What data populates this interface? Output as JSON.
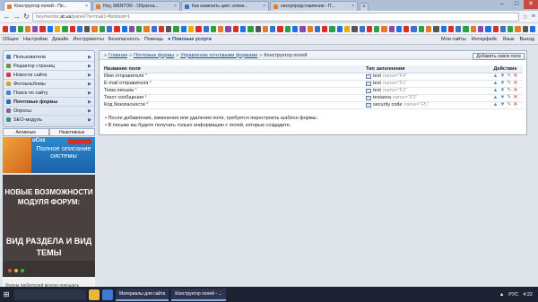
{
  "browser": {
    "tabs": [
      {
        "title": "Конструктор полей - По...",
        "active": true,
        "favicon_color": "#e57b2a"
      },
      {
        "title": "Hey, MENTOR - Обратна...",
        "active": false,
        "favicon_color": "#e57b2a"
      },
      {
        "title": "Как изменить цвет элеме...",
        "active": false,
        "favicon_color": "#3b6fd0"
      },
      {
        "title": "некорпредставления - П...",
        "active": false,
        "favicon_color": "#e57b2a"
      }
    ],
    "url_prefix": "heymentor.",
    "url_domain": "at.ua",
    "url_path": "/panel/?a=mail1=fieldsid=1",
    "bookmark_colors": [
      "#d93025",
      "#3b6fd0",
      "#2f9e44",
      "#e57b2a",
      "#8b4aa8",
      "#d93025",
      "#1a73e8",
      "#f2a900",
      "#2f9e44",
      "#d93025",
      "#3b6fd0",
      "#555",
      "#e57b2a",
      "#2f9e44",
      "#3b6fd0",
      "#d93025",
      "#1a73e8",
      "#8b4aa8",
      "#2f9e44",
      "#e57b2a",
      "#3b6fd0",
      "#d93025",
      "#555",
      "#2f9e44",
      "#1a73e8",
      "#f2a900",
      "#d93025",
      "#3b6fd0",
      "#2f9e44",
      "#e57b2a",
      "#8b4aa8",
      "#d93025",
      "#1a73e8",
      "#2f9e44",
      "#555",
      "#e57b2a",
      "#3b6fd0",
      "#d93025",
      "#2f9e44",
      "#1a73e8",
      "#8b4aa8",
      "#e57b2a",
      "#3b6fd0",
      "#d93025",
      "#2f9e44",
      "#1a73e8",
      "#f2a900",
      "#555",
      "#3b6fd0",
      "#d93025",
      "#2f9e44",
      "#e57b2a",
      "#8b4aa8",
      "#1a73e8",
      "#d93025",
      "#3b6fd0",
      "#2f9e44",
      "#e57b2a",
      "#555",
      "#1a73e8",
      "#d93025",
      "#3b6fd0",
      "#2f9e44",
      "#e57b2a",
      "#8b4aa8",
      "#1a73e8",
      "#d93025",
      "#3b6fd0",
      "#2f9e44",
      "#e57b2a",
      "#555",
      "#1a73e8"
    ]
  },
  "ucoz_bar": {
    "items": [
      "Общее",
      "Настройки",
      "Дизайн",
      "Инструменты",
      "Безопасность",
      "Помощь"
    ],
    "paid": "Платные услуги",
    "right": [
      "Мои сайты",
      "Интерфейс",
      "Язык",
      "Выход"
    ]
  },
  "sidebar": {
    "items": [
      {
        "label": "Пользователи",
        "color": "#4f7fc4",
        "bold": false
      },
      {
        "label": "Редактор страниц",
        "color": "#5b9a3f",
        "bold": false
      },
      {
        "label": "Новости сайта",
        "color": "#c7423a",
        "bold": false
      },
      {
        "label": "Фотоальбомы",
        "color": "#d9a12b",
        "bold": false
      },
      {
        "label": "Поиск по сайту",
        "color": "#4f7fc4",
        "bold": false
      },
      {
        "label": "Почтовые формы",
        "color": "#2f6fb8",
        "bold": true
      },
      {
        "label": "Опросы",
        "color": "#8a5fb0",
        "bold": false
      },
      {
        "label": "SEO-модуль",
        "color": "#3e8d7d",
        "bold": false
      }
    ],
    "tab_active": "Активные",
    "tab_inactive": "Неактивные"
  },
  "ads": {
    "ucoz_logo": "uCoz",
    "ucoz_text": "Полное описание системы",
    "forum_line1": "НОВЫЕ ВОЗМОЖНОСТИ МОДУЛЯ ФОРУМ:",
    "forum_line2": "ВИД РАЗДЕЛА И ВИД ТЕМЫ",
    "forum_caption": "Форум любителей вкусно покушать",
    "dot_colors": [
      "#e55050",
      "#f2b43a",
      "#4caf50"
    ]
  },
  "main": {
    "breadcrumbs": [
      "Главная",
      "Почтовые формы",
      "Управление почтовыми формами"
    ],
    "breadcrumb_current": "Конструктор полей",
    "add_button": "Добавить новое поле",
    "columns": {
      "name": "Название поля",
      "type": "Тип заполнения",
      "action": "Действие"
    },
    "rows": [
      {
        "name": "Имя отправителя",
        "type": "text",
        "fname": "name=\"F4\""
      },
      {
        "name": "E-mail отправителя",
        "type": "text",
        "fname": "name=\"F1\""
      },
      {
        "name": "Тема письма",
        "type": "text",
        "fname": "name=\"F2\""
      },
      {
        "name": "Текст сообщения",
        "type": "textarea",
        "fname": "name=\"F3\""
      },
      {
        "name": "Код безопасности",
        "type": "security code",
        "fname": "name=\"F5\""
      }
    ],
    "required_mark": "*",
    "notes": [
      "После добавления, изменения или удаления поля, требуется перестроить шаблон формы.",
      "В письме вы будете получать только информацию с полей, которые создадите."
    ]
  },
  "taskbar": {
    "search_placeholder": "",
    "apps": [
      "Материалы для сайта",
      "Конструктор полей - ..."
    ],
    "lang": "РУС",
    "time": "4:22"
  }
}
